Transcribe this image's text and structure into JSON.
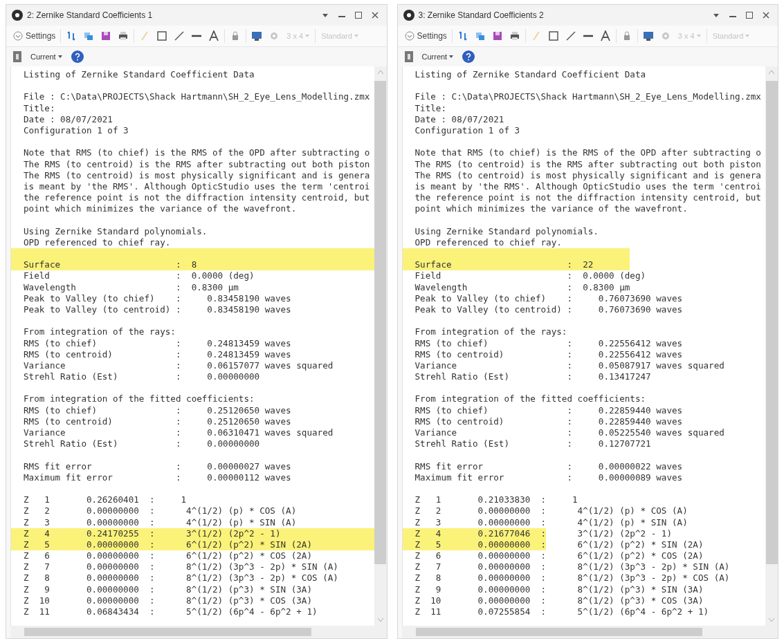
{
  "panels": [
    {
      "title": "2: Zernike Standard Coefficients 1",
      "settings_label": "Settings",
      "layout_button": {
        "label": "3 x 4",
        "disabled": true
      },
      "style_button": {
        "label": "Standard",
        "disabled": true
      },
      "config_label": "Current",
      "highlight_full_width": true,
      "lines": [
        {
          "kind": "text",
          "text": "Listing of Zernike Standard Coefficient Data",
          "highlighted": false
        },
        {
          "kind": "blank",
          "highlighted": false
        },
        {
          "kind": "text",
          "text": "File : C:\\Data\\PROJECTS\\Shack Hartmann\\SH_2_Eye_Lens_Modelling.zmx",
          "highlighted": false
        },
        {
          "kind": "text",
          "text": "Title:",
          "highlighted": false
        },
        {
          "kind": "text",
          "text": "Date : 08/07/2021",
          "highlighted": false
        },
        {
          "kind": "text",
          "text": "Configuration 1 of 3",
          "highlighted": false
        },
        {
          "kind": "blank",
          "highlighted": false
        },
        {
          "kind": "text",
          "text": "Note that RMS (to chief) is the RMS of the OPD after subtracting o",
          "highlighted": false
        },
        {
          "kind": "text",
          "text": "The RMS (to centroid) is the RMS after subtracting out both piston",
          "highlighted": false
        },
        {
          "kind": "text",
          "text": "The RMS (to centroid) is most physically significant and is genera",
          "highlighted": false
        },
        {
          "kind": "text",
          "text": "is meant by 'the RMS'. Although OpticStudio uses the term 'centroi",
          "highlighted": false
        },
        {
          "kind": "text",
          "text": "the reference point is not the diffraction intensity centroid, but",
          "highlighted": false
        },
        {
          "kind": "text",
          "text": "point which minimizes the variance of the wavefront.",
          "highlighted": false
        },
        {
          "kind": "blank",
          "highlighted": false
        },
        {
          "kind": "text",
          "text": "Using Zernike Standard polynomials.",
          "highlighted": false
        },
        {
          "kind": "text",
          "text": "OPD referenced to chief ray.",
          "highlighted": false
        },
        {
          "kind": "blank",
          "highlighted": true
        },
        {
          "kind": "text",
          "text": "Surface                      :  8",
          "highlighted": true
        },
        {
          "kind": "text",
          "text": "Field                        :  0.0000 (deg)",
          "highlighted": false
        },
        {
          "kind": "text",
          "text": "Wavelength                   :  0.8300 µm",
          "highlighted": false
        },
        {
          "kind": "text",
          "text": "Peak to Valley (to chief)    :     0.83458190 waves",
          "highlighted": false
        },
        {
          "kind": "text",
          "text": "Peak to Valley (to centroid) :     0.83458190 waves",
          "highlighted": false
        },
        {
          "kind": "blank",
          "highlighted": false
        },
        {
          "kind": "text",
          "text": "From integration of the rays:",
          "highlighted": false
        },
        {
          "kind": "text",
          "text": "RMS (to chief)               :     0.24813459 waves",
          "highlighted": false
        },
        {
          "kind": "text",
          "text": "RMS (to centroid)            :     0.24813459 waves",
          "highlighted": false
        },
        {
          "kind": "text",
          "text": "Variance                     :     0.06157077 waves squared",
          "highlighted": false
        },
        {
          "kind": "text",
          "text": "Strehl Ratio (Est)           :     0.00000000",
          "highlighted": false
        },
        {
          "kind": "blank",
          "highlighted": false
        },
        {
          "kind": "text",
          "text": "From integration of the fitted coefficients:",
          "highlighted": false
        },
        {
          "kind": "text",
          "text": "RMS (to chief)               :     0.25120650 waves",
          "highlighted": false
        },
        {
          "kind": "text",
          "text": "RMS (to centroid)            :     0.25120650 waves",
          "highlighted": false
        },
        {
          "kind": "text",
          "text": "Variance                     :     0.06310471 waves squared",
          "highlighted": false
        },
        {
          "kind": "text",
          "text": "Strehl Ratio (Est)           :     0.00000000",
          "highlighted": false
        },
        {
          "kind": "blank",
          "highlighted": false
        },
        {
          "kind": "text",
          "text": "RMS fit error                :     0.00000027 waves",
          "highlighted": false
        },
        {
          "kind": "text",
          "text": "Maximum fit error            :     0.00000112 waves",
          "highlighted": false
        },
        {
          "kind": "blank",
          "highlighted": false
        },
        {
          "kind": "zernike",
          "text": "Z   1       0.26260401  :     1",
          "highlighted": false
        },
        {
          "kind": "zernike",
          "text": "Z   2       0.00000000  :      4^(1/2) (p) * COS (A)",
          "highlighted": false
        },
        {
          "kind": "zernike",
          "text": "Z   3       0.00000000  :      4^(1/2) (p) * SIN (A)",
          "highlighted": false
        },
        {
          "kind": "zernike",
          "text": "Z   4       0.24170255  :      3^(1/2) (2p^2 - 1)",
          "highlighted": true
        },
        {
          "kind": "zernike",
          "text": "Z   5       0.00000000  :      6^(1/2) (p^2) * SIN (2A)",
          "highlighted": true
        },
        {
          "kind": "zernike",
          "text": "Z   6       0.00000000  :      6^(1/2) (p^2) * COS (2A)",
          "highlighted": false
        },
        {
          "kind": "zernike",
          "text": "Z   7       0.00000000  :      8^(1/2) (3p^3 - 2p) * SIN (A)",
          "highlighted": false
        },
        {
          "kind": "zernike",
          "text": "Z   8       0.00000000  :      8^(1/2) (3p^3 - 2p) * COS (A)",
          "highlighted": false
        },
        {
          "kind": "zernike",
          "text": "Z   9       0.00000000  :      8^(1/2) (p^3) * SIN (3A)",
          "highlighted": false
        },
        {
          "kind": "zernike",
          "text": "Z  10       0.00000000  :      8^(1/2) (p^3) * COS (3A)",
          "highlighted": false
        },
        {
          "kind": "zernike",
          "text": "Z  11       0.06843434  :      5^(1/2) (6p^4 - 6p^2 + 1)",
          "highlighted": false
        }
      ]
    },
    {
      "title": "3: Zernike Standard Coefficients 2",
      "settings_label": "Settings",
      "layout_button": {
        "label": "3 x 4",
        "disabled": true
      },
      "style_button": {
        "label": "Standard",
        "disabled": true
      },
      "config_label": "Current",
      "highlight_full_width": false,
      "lines": [
        {
          "kind": "text",
          "text": "Listing of Zernike Standard Coefficient Data",
          "highlighted": false
        },
        {
          "kind": "blank",
          "highlighted": false
        },
        {
          "kind": "text",
          "text": "File : C:\\Data\\PROJECTS\\Shack Hartmann\\SH_2_Eye_Lens_Modelling.zmx",
          "highlighted": false
        },
        {
          "kind": "text",
          "text": "Title:",
          "highlighted": false
        },
        {
          "kind": "text",
          "text": "Date : 08/07/2021",
          "highlighted": false
        },
        {
          "kind": "text",
          "text": "Configuration 1 of 3",
          "highlighted": false
        },
        {
          "kind": "blank",
          "highlighted": false
        },
        {
          "kind": "text",
          "text": "Note that RMS (to chief) is the RMS of the OPD after subtracting o",
          "highlighted": false
        },
        {
          "kind": "text",
          "text": "The RMS (to centroid) is the RMS after subtracting out both piston",
          "highlighted": false
        },
        {
          "kind": "text",
          "text": "The RMS (to centroid) is most physically significant and is genera",
          "highlighted": false
        },
        {
          "kind": "text",
          "text": "is meant by 'the RMS'. Although OpticStudio uses the term 'centroi",
          "highlighted": false
        },
        {
          "kind": "text",
          "text": "the reference point is not the diffraction intensity centroid, but",
          "highlighted": false
        },
        {
          "kind": "text",
          "text": "point which minimizes the variance of the wavefront.",
          "highlighted": false
        },
        {
          "kind": "blank",
          "highlighted": false
        },
        {
          "kind": "text",
          "text": "Using Zernike Standard polynomials.",
          "highlighted": false
        },
        {
          "kind": "text",
          "text": "OPD referenced to chief ray.",
          "highlighted": false
        },
        {
          "kind": "blank",
          "highlighted": true
        },
        {
          "kind": "text",
          "text": "Surface                      :  22",
          "highlighted": true
        },
        {
          "kind": "text",
          "text": "Field                        :  0.0000 (deg)",
          "highlighted": false
        },
        {
          "kind": "text",
          "text": "Wavelength                   :  0.8300 µm",
          "highlighted": false
        },
        {
          "kind": "text",
          "text": "Peak to Valley (to chief)    :     0.76073690 waves",
          "highlighted": false
        },
        {
          "kind": "text",
          "text": "Peak to Valley (to centroid) :     0.76073690 waves",
          "highlighted": false
        },
        {
          "kind": "blank",
          "highlighted": false
        },
        {
          "kind": "text",
          "text": "From integration of the rays:",
          "highlighted": false
        },
        {
          "kind": "text",
          "text": "RMS (to chief)               :     0.22556412 waves",
          "highlighted": false
        },
        {
          "kind": "text",
          "text": "RMS (to centroid)            :     0.22556412 waves",
          "highlighted": false
        },
        {
          "kind": "text",
          "text": "Variance                     :     0.05087917 waves squared",
          "highlighted": false
        },
        {
          "kind": "text",
          "text": "Strehl Ratio (Est)           :     0.13417247",
          "highlighted": false
        },
        {
          "kind": "blank",
          "highlighted": false
        },
        {
          "kind": "text",
          "text": "From integration of the fitted coefficients:",
          "highlighted": false
        },
        {
          "kind": "text",
          "text": "RMS (to chief)               :     0.22859440 waves",
          "highlighted": false
        },
        {
          "kind": "text",
          "text": "RMS (to centroid)            :     0.22859440 waves",
          "highlighted": false
        },
        {
          "kind": "text",
          "text": "Variance                     :     0.05225540 waves squared",
          "highlighted": false
        },
        {
          "kind": "text",
          "text": "Strehl Ratio (Est)           :     0.12707721",
          "highlighted": false
        },
        {
          "kind": "blank",
          "highlighted": false
        },
        {
          "kind": "text",
          "text": "RMS fit error                :     0.00000022 waves",
          "highlighted": false
        },
        {
          "kind": "text",
          "text": "Maximum fit error            :     0.00000089 waves",
          "highlighted": false
        },
        {
          "kind": "blank",
          "highlighted": false
        },
        {
          "kind": "zernike",
          "text": "Z   1       0.21033830  :     1",
          "highlighted": false
        },
        {
          "kind": "zernike",
          "text": "Z   2       0.00000000  :      4^(1/2) (p) * COS (A)",
          "highlighted": false
        },
        {
          "kind": "zernike",
          "text": "Z   3       0.00000000  :      4^(1/2) (p) * SIN (A)",
          "highlighted": false
        },
        {
          "kind": "zernike",
          "text": "Z   4       0.21677046  :      3^(1/2) (2p^2 - 1)",
          "highlighted": true
        },
        {
          "kind": "zernike",
          "text": "Z   5       0.00000000  :      6^(1/2) (p^2) * SIN (2A)",
          "highlighted": true
        },
        {
          "kind": "zernike",
          "text": "Z   6       0.00000000  :      6^(1/2) (p^2) * COS (2A)",
          "highlighted": false
        },
        {
          "kind": "zernike",
          "text": "Z   7       0.00000000  :      8^(1/2) (3p^3 - 2p) * SIN (A)",
          "highlighted": false
        },
        {
          "kind": "zernike",
          "text": "Z   8       0.00000000  :      8^(1/2) (3p^3 - 2p) * COS (A)",
          "highlighted": false
        },
        {
          "kind": "zernike",
          "text": "Z   9       0.00000000  :      8^(1/2) (p^3) * SIN (3A)",
          "highlighted": false
        },
        {
          "kind": "zernike",
          "text": "Z  10       0.00000000  :      8^(1/2) (p^3) * COS (3A)",
          "highlighted": false
        },
        {
          "kind": "zernike",
          "text": "Z  11       0.07255854  :      5^(1/2) (6p^4 - 6p^2 + 1)",
          "highlighted": false
        }
      ]
    }
  ]
}
